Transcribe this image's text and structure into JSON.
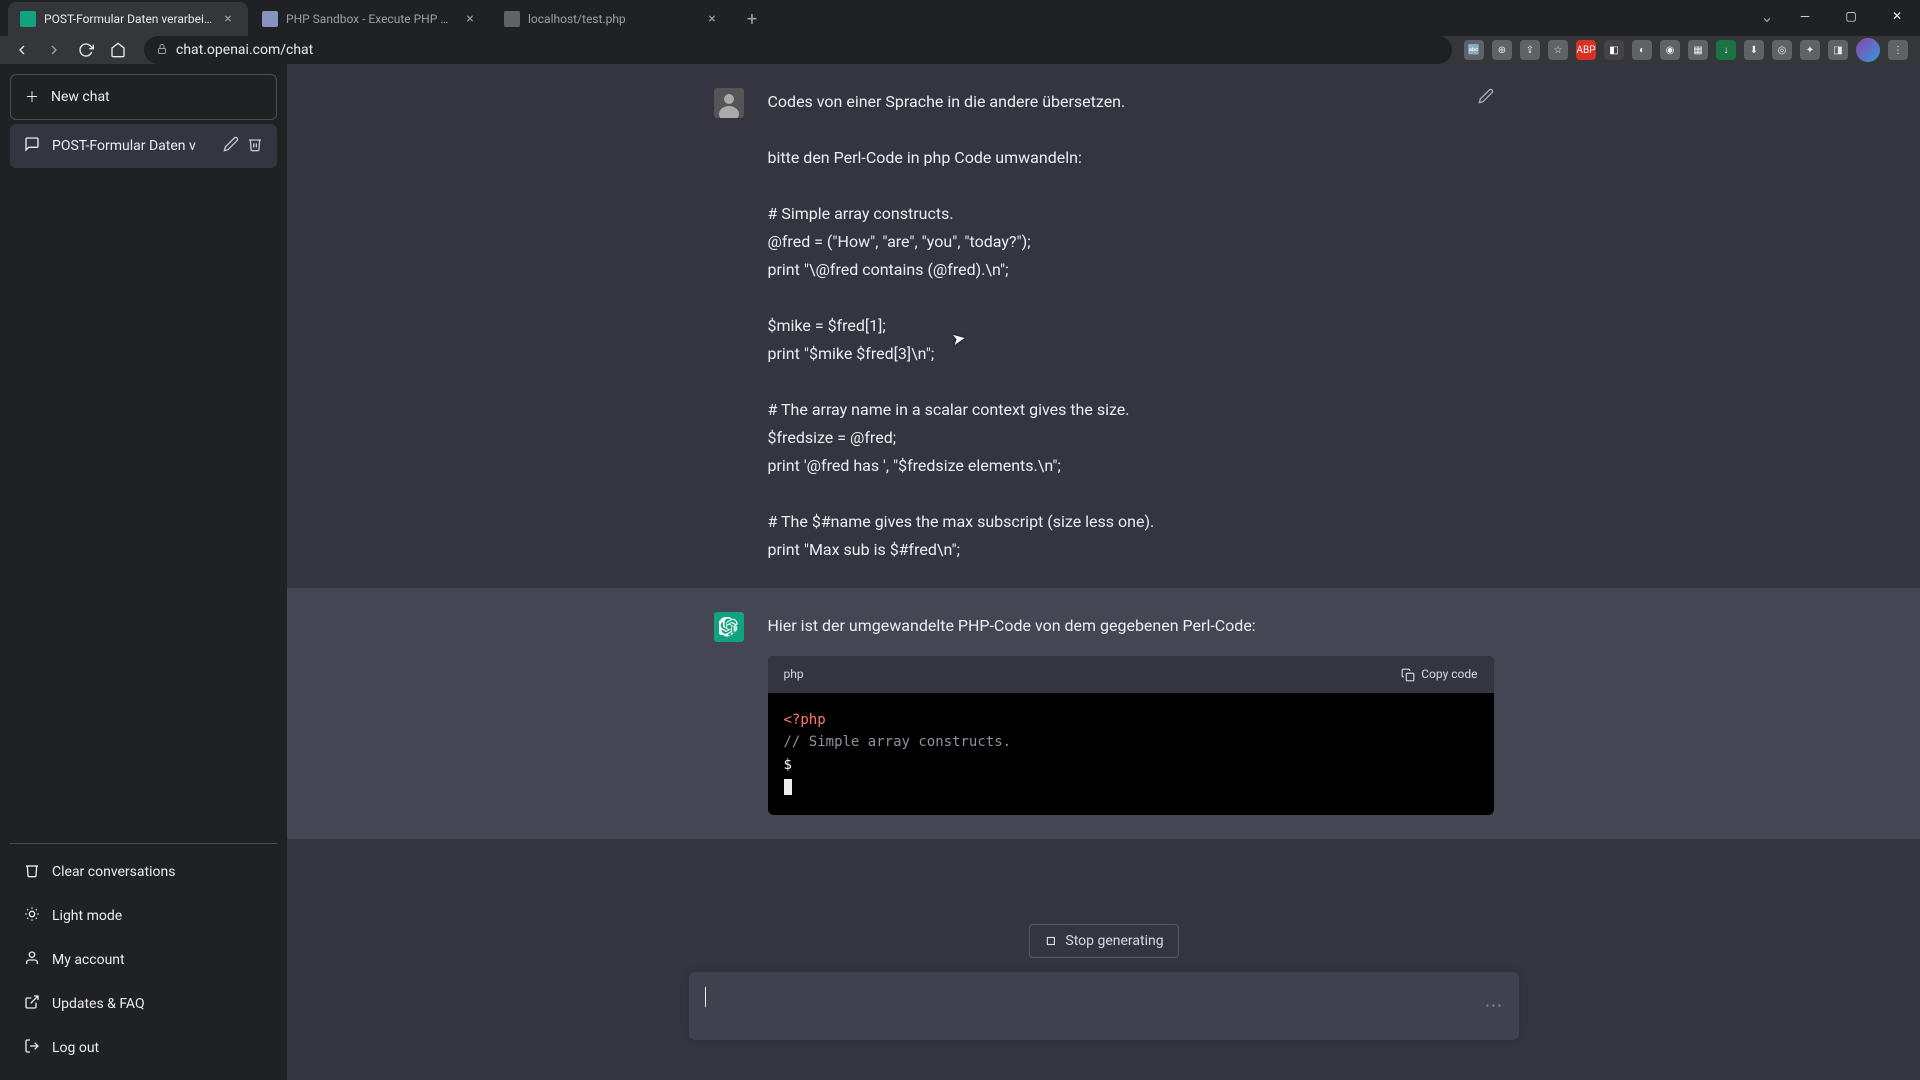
{
  "browser": {
    "tabs": [
      {
        "title": "POST-Formular Daten verarbeite",
        "active": true
      },
      {
        "title": "PHP Sandbox - Execute PHP code",
        "active": false
      },
      {
        "title": "localhost/test.php",
        "active": false
      }
    ],
    "url": "chat.openai.com/chat"
  },
  "sidebar": {
    "new_chat_label": "New chat",
    "conversations": [
      {
        "title": "POST-Formular Daten v"
      }
    ],
    "footer": {
      "clear": "Clear conversations",
      "theme": "Light mode",
      "account": "My account",
      "updates": "Updates & FAQ",
      "logout": "Log out"
    }
  },
  "chat": {
    "user_message": "Codes von einer Sprache in die andere übersetzen.\n\nbitte den Perl-Code in php Code umwandeln:\n\n# Simple array constructs.\n@fred = (\"How\", \"are\", \"you\", \"today?\");\nprint \"\\@fred contains (@fred).\\n\";\n\n$mike = $fred[1];\nprint \"$mike $fred[3]\\n\";\n\n# The array name in a scalar context gives the size.\n$fredsize = @fred;\nprint '@fred has ', \"$fredsize elements.\\n\";\n\n# The $#name gives the max subscript (size less one).\nprint \"Max sub is $#fred\\n\";",
    "assistant_intro": "Hier ist der umgewandelte PHP-Code von dem gegebenen Perl-Code:",
    "code_lang": "php",
    "copy_label": "Copy code",
    "code_line1": "<?php",
    "code_line2": "// Simple array constructs.",
    "code_line3": "$",
    "stop_label": "Stop generating"
  }
}
